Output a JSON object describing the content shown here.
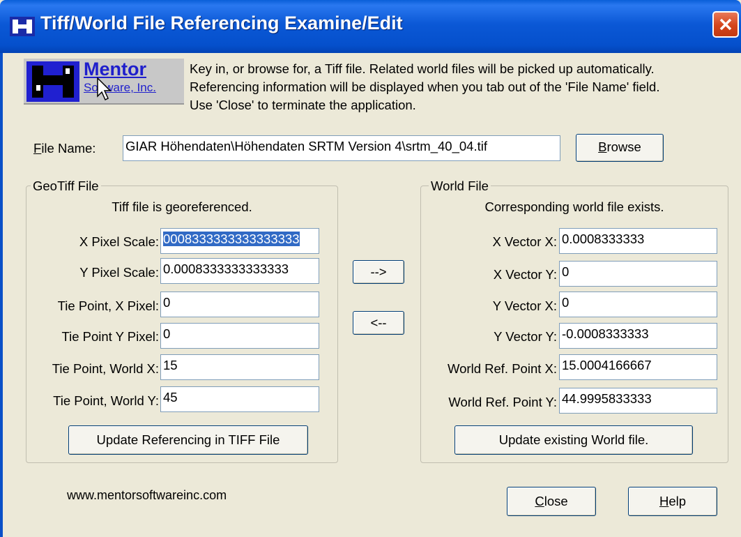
{
  "window": {
    "title": "Tiff/World File Referencing Examine/Edit"
  },
  "logo": {
    "name": "Mentor",
    "sub": "Software, Inc."
  },
  "intro": [
    "Key in, or browse for, a Tiff file.  Related world files will be picked up automatically.",
    "Referencing information will be displayed when you tab out of the 'File Name' field.",
    "Use 'Close' to terminate the application."
  ],
  "file": {
    "label_prefix": "",
    "label_accel": "F",
    "label_rest": "ile Name:",
    "value": "GIAR Höhendaten\\Höhendaten SRTM Version 4\\srtm_40_04.tif",
    "browse_accel": "B",
    "browse_rest": "rowse"
  },
  "geotiff": {
    "title": "GeoTiff File",
    "status": "Tiff file is georeferenced.",
    "fields": [
      {
        "label": "X Pixel Scale:",
        "value": "0008333333333333333"
      },
      {
        "label": "Y Pixel Scale:",
        "value": "0.0008333333333333"
      },
      {
        "label": "Tie Point, X Pixel:",
        "value": "0"
      },
      {
        "label": "Tie Point Y Pixel:",
        "value": "0"
      },
      {
        "label": "Tie Point, World X:",
        "value": "15"
      },
      {
        "label": "Tie Point, World Y:",
        "value": "45"
      }
    ],
    "update_button": "Update Referencing in TIFF File"
  },
  "transfer": {
    "to_world": "-->",
    "to_tiff": "<--"
  },
  "world": {
    "title": "World File",
    "status": "Corresponding world file exists.",
    "fields": [
      {
        "label": "X Vector X:",
        "value": "0.0008333333"
      },
      {
        "label": "X Vector Y:",
        "value": "0"
      },
      {
        "label": "Y Vector X:",
        "value": "0"
      },
      {
        "label": "Y Vector Y:",
        "value": "-0.0008333333"
      },
      {
        "label": "World Ref. Point X:",
        "value": "15.0004166667"
      },
      {
        "label": "World Ref. Point Y:",
        "value": "44.9995833333"
      }
    ],
    "update_button": "Update existing World file."
  },
  "footer": {
    "url": "www.mentorsoftwareinc.com",
    "close_accel": "C",
    "close_rest": "lose",
    "help_accel": "H",
    "help_rest": "elp"
  },
  "colors": {
    "titlebar": "#0550CC",
    "selection": "#316AC5",
    "dialog_bg": "#ECE9D8",
    "logo_blue": "#1F1FCC"
  },
  "icons": {
    "title": "app-icon",
    "close": "close-icon",
    "cursor": "pointer-cursor-icon"
  }
}
